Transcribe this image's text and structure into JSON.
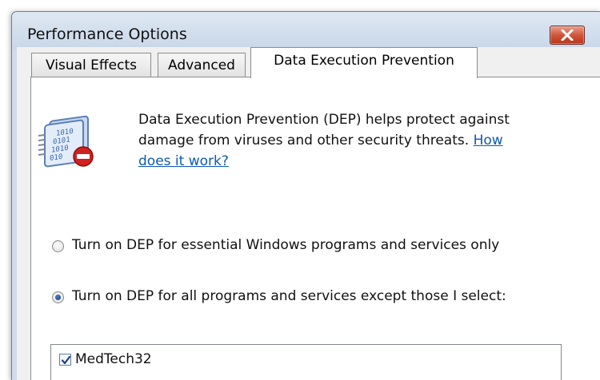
{
  "window": {
    "title": "Performance Options",
    "close_icon": "close-icon",
    "accent_close": "#c8452a"
  },
  "tabs": [
    {
      "label": "Visual Effects",
      "active": false
    },
    {
      "label": "Advanced",
      "active": false
    },
    {
      "label": "Data Execution Prevention",
      "active": true
    }
  ],
  "dep": {
    "icon": "dep-binary-document-icon",
    "description": "Data Execution Prevention (DEP) helps protect against damage from viruses and other security threats.",
    "link_text": "How does it work?"
  },
  "options": [
    {
      "label": "Turn on DEP for essential Windows programs and services only",
      "selected": false
    },
    {
      "label": "Turn on DEP for all programs and services except those I select:",
      "selected": true
    }
  ],
  "exceptions": [
    {
      "name": "MedTech32",
      "checked": true
    }
  ]
}
